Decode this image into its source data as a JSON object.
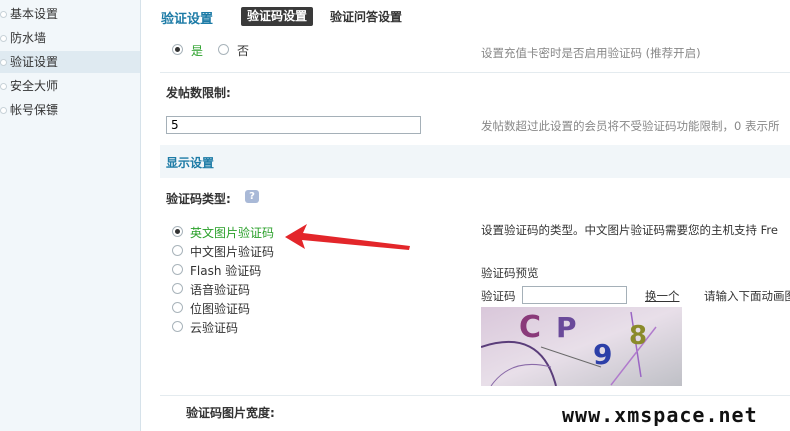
{
  "sidebar": {
    "items": [
      {
        "label": "基本设置"
      },
      {
        "label": "防水墙"
      },
      {
        "label": "验证设置"
      },
      {
        "label": "安全大师"
      },
      {
        "label": "帐号保镖"
      }
    ]
  },
  "header": {
    "title": "验证设置",
    "tabs": [
      {
        "label": "验证码设置"
      },
      {
        "label": "验证问答设置"
      }
    ]
  },
  "enable_row": {
    "yes_label": "是",
    "no_label": "否",
    "hint": "设置充值卡密时是否启用验证码 (推荐开启)"
  },
  "post_limit": {
    "label": "发帖数限制:",
    "value": "5",
    "hint": "发帖数超过此设置的会员将不受验证码功能限制，0 表示所"
  },
  "display_section": {
    "title": "显示设置"
  },
  "captcha_type": {
    "label": "验证码类型:",
    "help_icon": "question-icon",
    "options": [
      {
        "label": "英文图片验证码",
        "checked": true
      },
      {
        "label": "中文图片验证码",
        "checked": false
      },
      {
        "label": "Flash 验证码",
        "checked": false
      },
      {
        "label": "语音验证码",
        "checked": false
      },
      {
        "label": "位图验证码",
        "checked": false
      },
      {
        "label": "云验证码",
        "checked": false
      }
    ],
    "hint": "设置验证码的类型。中文图片验证码需要您的主机支持 Fre"
  },
  "preview": {
    "title": "验证码预览",
    "field_label": "验证码",
    "refresh_link": "换一个",
    "instruction": "请输入下面动画图",
    "captcha_chars": "CP98"
  },
  "image_width": {
    "label": "验证码图片宽度:"
  },
  "watermark": "www.xmspace.net",
  "colors": {
    "accent": "#1d7ba6",
    "selected_option": "#2aa02a",
    "arrow": "#e3262a"
  }
}
